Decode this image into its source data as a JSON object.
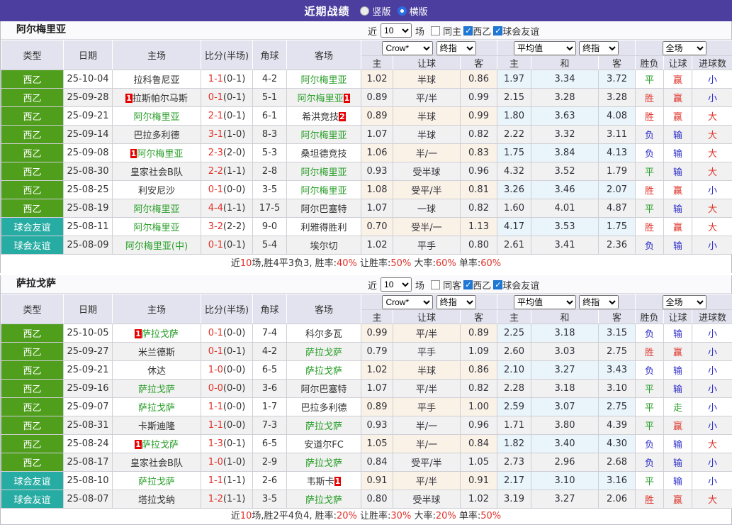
{
  "topbar": {
    "title": "近期战绩",
    "radios": [
      {
        "label": "竖版",
        "checked": false
      },
      {
        "label": "横版",
        "checked": true
      }
    ]
  },
  "labels": {
    "near": "近",
    "games": "场"
  },
  "table_header": {
    "cols": [
      "类型",
      "日期",
      "主场",
      "比分(半场)",
      "角球",
      "客场"
    ],
    "crown_select": "Crow*",
    "final_select": "终指",
    "avg_select": "平均值",
    "scope_select": "全场",
    "sub": [
      "主",
      "让球",
      "客",
      "主",
      "和",
      "客",
      "胜负",
      "让球",
      "进球数"
    ]
  },
  "colors": {
    "accent_purple": "#4b3e9e",
    "league_badge": "#4f9e1c",
    "friendly_badge": "#27aca3",
    "team_green": "#2a9e2a",
    "win_red": "#e0322a",
    "draw_green": "#2a9e2a",
    "lose_blue": "#2d2dc9",
    "checked_blue": "#1e78d7"
  },
  "sections": [
    {
      "team": "阿尔梅里亚",
      "near_count": "10",
      "checkboxes": [
        {
          "label": "同主",
          "checked": false
        },
        {
          "label": "西乙",
          "checked": true
        },
        {
          "label": "球会友谊",
          "checked": true
        }
      ],
      "rows": [
        {
          "type": "西乙",
          "style": "league",
          "date": "25-10-04",
          "home": "拉科鲁尼亚",
          "home_card": null,
          "away": "阿尔梅里亚",
          "away_card": null,
          "self": "away",
          "ft": "1-1",
          "ht": "(0-1)",
          "corner": "4-2",
          "crown": [
            "1.02",
            "半球",
            "0.86"
          ],
          "avg": [
            "1.97",
            "3.34",
            "3.72"
          ],
          "res": [
            "平",
            "赢",
            "小"
          ]
        },
        {
          "type": "西乙",
          "style": "league",
          "date": "25-09-28",
          "home": "拉斯帕尔马斯",
          "home_card": "1",
          "away": "阿尔梅里亚",
          "away_card": "1",
          "self": "away",
          "ft": "0-1",
          "ht": "(0-1)",
          "corner": "5-1",
          "crown": [
            "0.89",
            "平/半",
            "0.99"
          ],
          "avg": [
            "2.15",
            "3.28",
            "3.28"
          ],
          "res": [
            "胜",
            "赢",
            "小"
          ]
        },
        {
          "type": "西乙",
          "style": "league",
          "date": "25-09-21",
          "home": "阿尔梅里亚",
          "home_card": null,
          "away": "希洪竞技",
          "away_card": "2",
          "self": "home",
          "ft": "2-1",
          "ht": "(0-1)",
          "corner": "6-1",
          "crown": [
            "0.89",
            "半球",
            "0.99"
          ],
          "avg": [
            "1.80",
            "3.63",
            "4.08"
          ],
          "res": [
            "胜",
            "赢",
            "大"
          ]
        },
        {
          "type": "西乙",
          "style": "league",
          "date": "25-09-14",
          "home": "巴拉多利德",
          "home_card": null,
          "away": "阿尔梅里亚",
          "away_card": null,
          "self": "away",
          "ft": "3-1",
          "ht": "(1-0)",
          "corner": "8-3",
          "crown": [
            "1.07",
            "半球",
            "0.82"
          ],
          "avg": [
            "2.22",
            "3.32",
            "3.11"
          ],
          "res": [
            "负",
            "输",
            "大"
          ]
        },
        {
          "type": "西乙",
          "style": "league",
          "date": "25-09-08",
          "home": "阿尔梅里亚",
          "home_card": "1",
          "away": "桑坦德竞技",
          "away_card": null,
          "self": "home",
          "ft": "2-3",
          "ht": "(2-0)",
          "corner": "5-3",
          "crown": [
            "1.06",
            "半/一",
            "0.83"
          ],
          "avg": [
            "1.75",
            "3.84",
            "4.13"
          ],
          "res": [
            "负",
            "输",
            "大"
          ]
        },
        {
          "type": "西乙",
          "style": "league",
          "date": "25-08-30",
          "home": "皇家社会B队",
          "home_card": null,
          "away": "阿尔梅里亚",
          "away_card": null,
          "self": "away",
          "ft": "2-2",
          "ht": "(1-1)",
          "corner": "2-8",
          "crown": [
            "0.93",
            "受半球",
            "0.96"
          ],
          "avg": [
            "4.32",
            "3.52",
            "1.79"
          ],
          "res": [
            "平",
            "输",
            "大"
          ]
        },
        {
          "type": "西乙",
          "style": "league",
          "date": "25-08-25",
          "home": "利安尼沙",
          "home_card": null,
          "away": "阿尔梅里亚",
          "away_card": null,
          "self": "away",
          "ft": "0-1",
          "ht": "(0-0)",
          "corner": "3-5",
          "crown": [
            "1.08",
            "受平/半",
            "0.81"
          ],
          "avg": [
            "3.26",
            "3.46",
            "2.07"
          ],
          "res": [
            "胜",
            "赢",
            "小"
          ]
        },
        {
          "type": "西乙",
          "style": "league",
          "date": "25-08-19",
          "home": "阿尔梅里亚",
          "home_card": null,
          "away": "阿尔巴塞特",
          "away_card": null,
          "self": "home",
          "ft": "4-4",
          "ht": "(1-1)",
          "corner": "17-5",
          "crown": [
            "1.07",
            "一球",
            "0.82"
          ],
          "avg": [
            "1.60",
            "4.01",
            "4.87"
          ],
          "res": [
            "平",
            "输",
            "大"
          ]
        },
        {
          "type": "球会友谊",
          "style": "friendly",
          "date": "25-08-11",
          "home": "阿尔梅里亚",
          "home_card": null,
          "away": "利雅得胜利",
          "away_card": null,
          "self": "home",
          "ft": "3-2",
          "ht": "(2-2)",
          "corner": "9-0",
          "crown": [
            "0.70",
            "受半/一",
            "1.13"
          ],
          "avg": [
            "4.17",
            "3.53",
            "1.75"
          ],
          "res": [
            "胜",
            "赢",
            "大"
          ]
        },
        {
          "type": "球会友谊",
          "style": "friendly",
          "date": "25-08-09",
          "home": "阿尔梅里亚(中)",
          "home_card": null,
          "away": "埃尔切",
          "away_card": null,
          "self": "home",
          "ft": "0-1",
          "ht": "(0-1)",
          "corner": "5-4",
          "crown": [
            "1.02",
            "平手",
            "0.80"
          ],
          "avg": [
            "2.61",
            "3.41",
            "2.36"
          ],
          "res": [
            "负",
            "输",
            "小"
          ]
        }
      ],
      "footer": [
        [
          "近",
          0
        ],
        [
          "10",
          1
        ],
        [
          "场,胜4平3负3, 胜率:",
          0
        ],
        [
          "40%",
          1
        ],
        [
          " 让胜率:",
          0
        ],
        [
          "50%",
          1
        ],
        [
          " 大率:",
          0
        ],
        [
          "60%",
          1
        ],
        [
          " 单率:",
          0
        ],
        [
          "60%",
          1
        ]
      ]
    },
    {
      "team": "萨拉戈萨",
      "near_count": "10",
      "checkboxes": [
        {
          "label": "同客",
          "checked": false
        },
        {
          "label": "西乙",
          "checked": true
        },
        {
          "label": "球会友谊",
          "checked": true
        }
      ],
      "rows": [
        {
          "type": "西乙",
          "style": "league",
          "date": "25-10-05",
          "home": "萨拉戈萨",
          "home_card": "1",
          "away": "科尔多瓦",
          "away_card": null,
          "self": "home",
          "ft": "0-1",
          "ht": "(0-0)",
          "corner": "7-4",
          "crown": [
            "0.99",
            "平/半",
            "0.89"
          ],
          "avg": [
            "2.25",
            "3.18",
            "3.15"
          ],
          "res": [
            "负",
            "输",
            "小"
          ]
        },
        {
          "type": "西乙",
          "style": "league",
          "date": "25-09-27",
          "home": "米兰德斯",
          "home_card": null,
          "away": "萨拉戈萨",
          "away_card": null,
          "self": "away",
          "ft": "0-1",
          "ht": "(0-1)",
          "corner": "4-2",
          "crown": [
            "0.79",
            "平手",
            "1.09"
          ],
          "avg": [
            "2.60",
            "3.03",
            "2.75"
          ],
          "res": [
            "胜",
            "赢",
            "小"
          ]
        },
        {
          "type": "西乙",
          "style": "league",
          "date": "25-09-21",
          "home": "休达",
          "home_card": null,
          "away": "萨拉戈萨",
          "away_card": null,
          "self": "away",
          "ft": "1-0",
          "ht": "(0-0)",
          "corner": "6-5",
          "crown": [
            "1.02",
            "半球",
            "0.86"
          ],
          "avg": [
            "2.10",
            "3.27",
            "3.43"
          ],
          "res": [
            "负",
            "输",
            "小"
          ]
        },
        {
          "type": "西乙",
          "style": "league",
          "date": "25-09-16",
          "home": "萨拉戈萨",
          "home_card": null,
          "away": "阿尔巴塞特",
          "away_card": null,
          "self": "home",
          "ft": "0-0",
          "ht": "(0-0)",
          "corner": "3-6",
          "crown": [
            "1.07",
            "平/半",
            "0.82"
          ],
          "avg": [
            "2.28",
            "3.18",
            "3.10"
          ],
          "res": [
            "平",
            "输",
            "小"
          ]
        },
        {
          "type": "西乙",
          "style": "league",
          "date": "25-09-07",
          "home": "萨拉戈萨",
          "home_card": null,
          "away": "巴拉多利德",
          "away_card": null,
          "self": "home",
          "ft": "1-1",
          "ht": "(0-0)",
          "corner": "1-7",
          "crown": [
            "0.89",
            "平手",
            "1.00"
          ],
          "avg": [
            "2.59",
            "3.07",
            "2.75"
          ],
          "res": [
            "平",
            "走",
            "小"
          ]
        },
        {
          "type": "西乙",
          "style": "league",
          "date": "25-08-31",
          "home": "卡斯迪隆",
          "home_card": null,
          "away": "萨拉戈萨",
          "away_card": null,
          "self": "away",
          "ft": "1-1",
          "ht": "(0-0)",
          "corner": "7-3",
          "crown": [
            "0.93",
            "半/一",
            "0.96"
          ],
          "avg": [
            "1.71",
            "3.80",
            "4.39"
          ],
          "res": [
            "平",
            "赢",
            "小"
          ]
        },
        {
          "type": "西乙",
          "style": "league",
          "date": "25-08-24",
          "home": "萨拉戈萨",
          "home_card": "1",
          "away": "安道尔FC",
          "away_card": null,
          "self": "home",
          "ft": "1-3",
          "ht": "(0-1)",
          "corner": "6-5",
          "crown": [
            "1.05",
            "半/一",
            "0.84"
          ],
          "avg": [
            "1.82",
            "3.40",
            "4.30"
          ],
          "res": [
            "负",
            "输",
            "大"
          ]
        },
        {
          "type": "西乙",
          "style": "league",
          "date": "25-08-17",
          "home": "皇家社会B队",
          "home_card": null,
          "away": "萨拉戈萨",
          "away_card": null,
          "self": "away",
          "ft": "1-0",
          "ht": "(1-0)",
          "corner": "2-9",
          "crown": [
            "0.84",
            "受平/半",
            "1.05"
          ],
          "avg": [
            "2.73",
            "2.96",
            "2.68"
          ],
          "res": [
            "负",
            "输",
            "小"
          ]
        },
        {
          "type": "球会友谊",
          "style": "friendly",
          "date": "25-08-10",
          "home": "萨拉戈萨",
          "home_card": null,
          "away": "韦斯卡",
          "away_card": "1",
          "self": "home",
          "ft": "1-1",
          "ht": "(1-1)",
          "corner": "2-6",
          "crown": [
            "0.91",
            "平/半",
            "0.91"
          ],
          "avg": [
            "2.17",
            "3.10",
            "3.16"
          ],
          "res": [
            "平",
            "输",
            "小"
          ]
        },
        {
          "type": "球会友谊",
          "style": "friendly",
          "date": "25-08-07",
          "home": "塔拉戈纳",
          "home_card": null,
          "away": "萨拉戈萨",
          "away_card": null,
          "self": "away",
          "ft": "1-2",
          "ht": "(1-1)",
          "corner": "3-5",
          "crown": [
            "0.80",
            "受半球",
            "1.02"
          ],
          "avg": [
            "3.19",
            "3.27",
            "2.06"
          ],
          "res": [
            "胜",
            "赢",
            "大"
          ]
        }
      ],
      "footer": [
        [
          "近",
          0
        ],
        [
          "10",
          1
        ],
        [
          "场,胜2平4负4, 胜率:",
          0
        ],
        [
          "20%",
          1
        ],
        [
          " 让胜率:",
          0
        ],
        [
          "30%",
          1
        ],
        [
          " 大率:",
          0
        ],
        [
          "20%",
          1
        ],
        [
          " 单率:",
          0
        ],
        [
          "50%",
          1
        ]
      ]
    }
  ]
}
